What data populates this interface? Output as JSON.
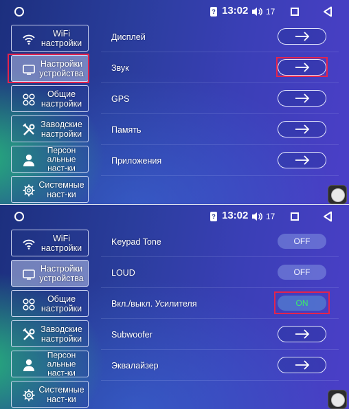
{
  "status": {
    "signal_glyph": "?",
    "time": "13:02",
    "volume": "17"
  },
  "sidebar": {
    "items": [
      {
        "label": "WiFi\nнастройки",
        "icon": "wifi-icon"
      },
      {
        "label": "Настройки\nустройства",
        "icon": "monitor-icon"
      },
      {
        "label": "Общие\nнастройки",
        "icon": "grid-icon"
      },
      {
        "label": "Заводские\nнастройки",
        "icon": "tools-icon"
      },
      {
        "label": "Персон\nальные\nнаст-ки",
        "icon": "person-icon"
      },
      {
        "label": "Системные\nнаст-ки",
        "icon": "gear-icon"
      }
    ],
    "active_index": 1
  },
  "device_menu": {
    "rows": [
      {
        "label": "Дисплей",
        "control": "arrow"
      },
      {
        "label": "Звук",
        "control": "arrow"
      },
      {
        "label": "GPS",
        "control": "arrow"
      },
      {
        "label": "Память",
        "control": "arrow"
      },
      {
        "label": "Приложения",
        "control": "arrow"
      }
    ]
  },
  "sound_menu": {
    "rows": [
      {
        "label": "Keypad Tone",
        "control": "toggle",
        "value": "OFF"
      },
      {
        "label": "LOUD",
        "control": "toggle",
        "value": "OFF"
      },
      {
        "label": "Вкл./выкл. Усилителя",
        "control": "toggle",
        "value": "ON"
      },
      {
        "label": "Subwoofer",
        "control": "arrow"
      },
      {
        "label": "Эквалайзер",
        "control": "arrow"
      }
    ]
  },
  "colors": {
    "highlight": "#e3244d",
    "toggle_on": "#38f06a",
    "background_left": "#1c2f7e",
    "background_right": "#4b3fc8"
  }
}
